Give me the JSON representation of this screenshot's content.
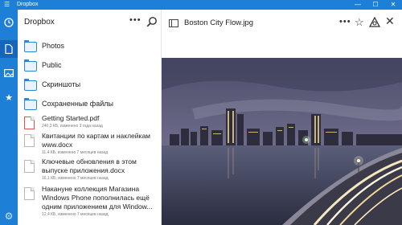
{
  "window": {
    "title": "Dropbox",
    "menu_icon": "hamburger-icon",
    "minimize": "—",
    "maximize": "☐",
    "close": "✕"
  },
  "rail": [
    {
      "icon": "clock-icon",
      "glyph": "◔"
    },
    {
      "icon": "file-icon",
      "glyph": "▤"
    },
    {
      "icon": "photo-icon",
      "glyph": "▣"
    },
    {
      "icon": "star-icon",
      "glyph": "★"
    },
    {
      "icon": "settings-icon",
      "glyph": "⚙"
    }
  ],
  "pane": {
    "title": "Dropbox",
    "more": "•••"
  },
  "folders": [
    {
      "label": "Photos"
    },
    {
      "label": "Public"
    },
    {
      "label": "Скриншоты"
    },
    {
      "label": "Сохраненные файлы"
    }
  ],
  "files": [
    {
      "name": "Getting Started.pdf",
      "meta": "240,2 КБ, изменено 3 года назад",
      "type": "pdf"
    },
    {
      "name": "Квитанции по картам и наклейкам www.docx",
      "meta": "11,4 КБ, изменено 7 месяцев назад",
      "type": "doc"
    },
    {
      "name": "Ключевые обновления в этом выпуске приложения.docx",
      "meta": "16,1 КБ, изменено 7 месяцев назад",
      "type": "doc"
    },
    {
      "name": "Накануне коллекция Магазина Windows Phone пополнилась ещё одним приложением для Window...",
      "meta": "12,4 КБ, изменено 7 месяцев назад",
      "type": "doc"
    }
  ],
  "viewer": {
    "title": "Boston City Flow.jpg",
    "more": "•••",
    "star": "☆",
    "close": "✕"
  },
  "colors": {
    "accent": "#1e7fd6",
    "accent_dark": "#1565b8"
  }
}
